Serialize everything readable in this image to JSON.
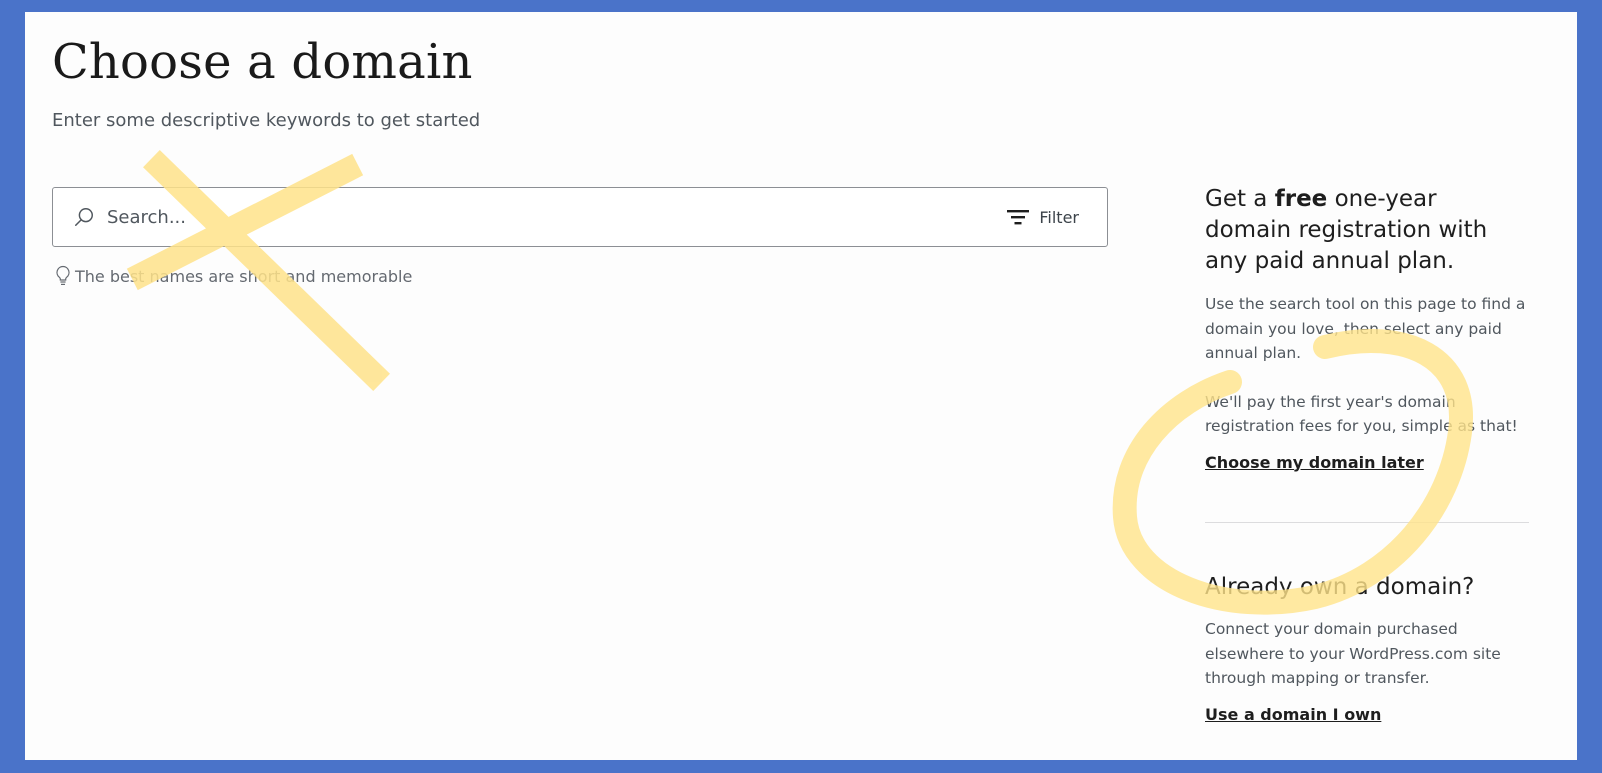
{
  "page": {
    "title": "Choose a domain",
    "subtitle": "Enter some descriptive keywords to get started"
  },
  "search": {
    "placeholder": "Search...",
    "value": "",
    "icon": "search-icon",
    "filter_label": "Filter",
    "filter_icon": "filter-icon"
  },
  "hint": {
    "icon": "lightbulb-icon",
    "text": "The best names are short and memorable"
  },
  "promo": {
    "title_prefix": "Get a ",
    "title_bold": "free",
    "title_suffix": " one-year domain registration with any paid annual plan.",
    "para1": "Use the search tool on this page to find a domain you love, then select any paid annual plan.",
    "para2": "We'll pay the first year's domain registration fees for you, simple as that!",
    "link": "Choose my domain later"
  },
  "own_domain": {
    "title": "Already own a domain?",
    "text": "Connect your domain purchased elsewhere to your WordPress.com site through mapping or transfer.",
    "link": "Use a domain I own"
  },
  "colors": {
    "border_frame": "#4a73c9",
    "background": "#fdfdfd",
    "highlighter": "#ffe38a"
  }
}
